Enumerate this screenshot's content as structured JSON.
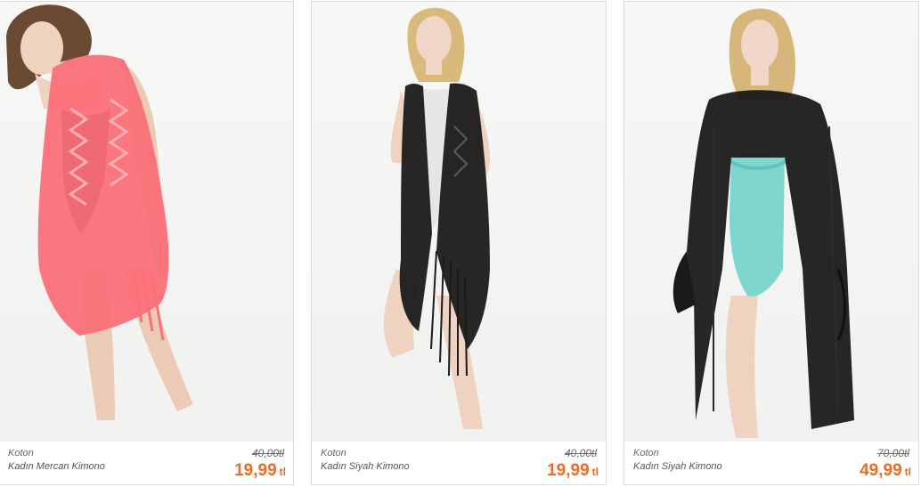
{
  "products": [
    {
      "brand": "Koton",
      "name": "Kadın Mercan Kimono",
      "old_price": "40,00tl",
      "price": "19,99",
      "currency": "tl",
      "garment_color": "#fb6f78"
    },
    {
      "brand": "Koton",
      "name": "Kadın Siyah Kimono",
      "old_price": "40,00tl",
      "price": "19,99",
      "currency": "tl",
      "garment_color": "#1b1b1b"
    },
    {
      "brand": "Koton",
      "name": "Kadın Siyah Kimono",
      "old_price": "70,00tl",
      "price": "49,99",
      "currency": "tl",
      "garment_color": "#1a1a1a"
    }
  ],
  "colors": {
    "price_accent": "#f26a1b",
    "border": "#dcdcdc",
    "swimsuit_black": "#141414",
    "swimsuit_turquoise": "#7fd6cf"
  }
}
